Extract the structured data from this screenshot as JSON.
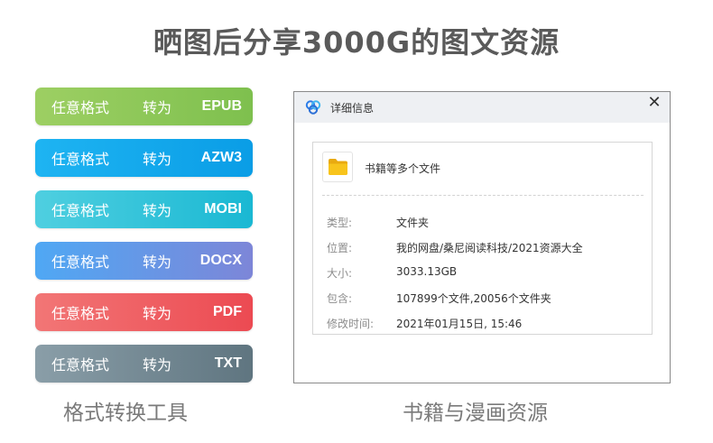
{
  "headline": "晒图后分享3000G的图文资源",
  "converter": {
    "buttons": [
      {
        "from": "任意格式",
        "verb": "转为",
        "format": "EPUB",
        "color_start": "#9dcf63",
        "color_end": "#7ec04e"
      },
      {
        "from": "任意格式",
        "verb": "转为",
        "format": "AZW3",
        "color_start": "#1eb4f2",
        "color_end": "#0a9de6"
      },
      {
        "from": "任意格式",
        "verb": "转为",
        "format": "MOBI",
        "color_start": "#4fcfe0",
        "color_end": "#1ab8d3"
      },
      {
        "from": "任意格式",
        "verb": "转为",
        "format": "DOCX",
        "color_start": "#4fa8f4",
        "color_end": "#7d86d8"
      },
      {
        "from": "任意格式",
        "verb": "转为",
        "format": "PDF",
        "color_start": "#f27676",
        "color_end": "#ec4a52"
      },
      {
        "from": "任意格式",
        "verb": "转为",
        "format": "TXT",
        "color_start": "#8a9ea8",
        "color_end": "#5f7580"
      }
    ],
    "caption": "格式转换工具"
  },
  "dialog": {
    "title": "详细信息",
    "close_glyph": "✕",
    "file_name": "书籍等多个文件",
    "properties": [
      {
        "label": "类型:",
        "value": "文件夹"
      },
      {
        "label": "位置:",
        "value": "我的网盘/桑尼阅读科技/2021资源大全"
      },
      {
        "label": "大小:",
        "value": "3033.13GB"
      },
      {
        "label": "包含:",
        "value": "107899个文件,20056个文件夹"
      },
      {
        "label": "修改时间:",
        "value": "2021年01月15日, 15:46"
      }
    ],
    "caption": "书籍与漫画资源",
    "logo_icon": "baidu-netdisk-logo-icon",
    "folder_icon": "folder-icon",
    "folder_color": "#f8c41c"
  }
}
